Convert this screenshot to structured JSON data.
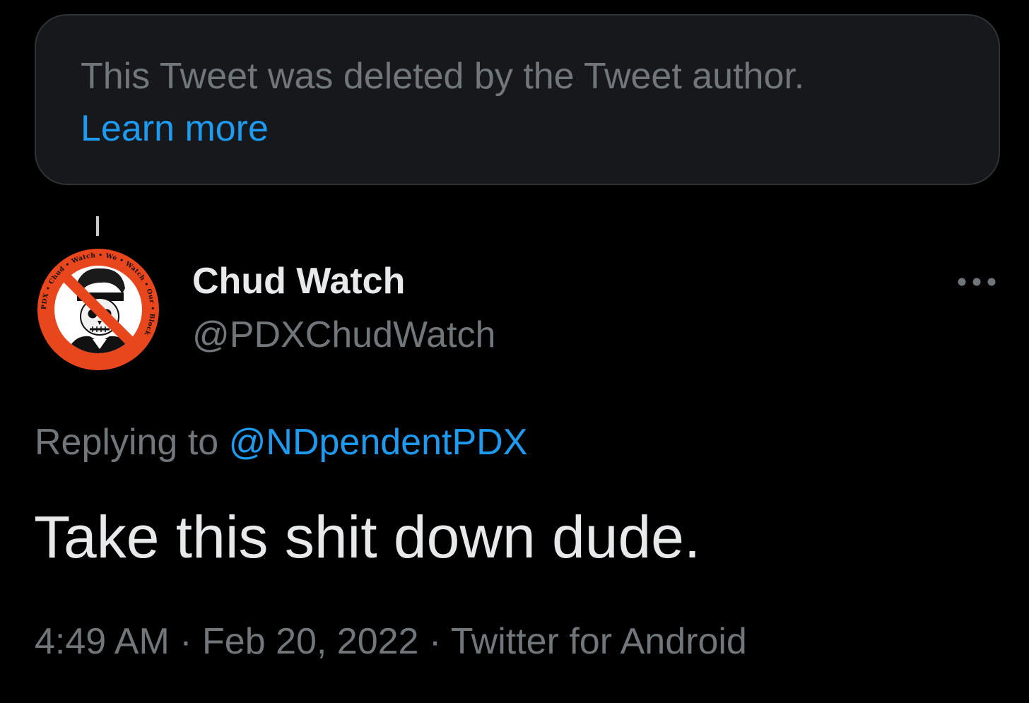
{
  "deleted_notice": {
    "message": "This Tweet was deleted by the Tweet author.",
    "learn_more_label": "Learn more"
  },
  "tweet": {
    "author": {
      "display_name": "Chud Watch",
      "handle": "@PDXChudWatch",
      "avatar_icon": "pdx-chud-watch-logo-icon",
      "avatar_ring_text": "PDX • Chud • Watch • We • Watch • Our • Block"
    },
    "reply": {
      "prefix": "Replying to ",
      "handle": "@NDpendentPDX"
    },
    "text": "Take this shit down dude.",
    "meta": {
      "time": "4:49 AM",
      "separator": " · ",
      "date": "Feb 20, 2022",
      "source": "Twitter for Android"
    },
    "more_icon": "more-horizontal-icon"
  },
  "colors": {
    "background": "#000000",
    "card_background": "#16181c",
    "card_border": "#2f3336",
    "primary_text": "#e7e9ea",
    "secondary_text": "#71767b",
    "accent": "#1d9bf0",
    "avatar_ring": "#e8461c"
  }
}
